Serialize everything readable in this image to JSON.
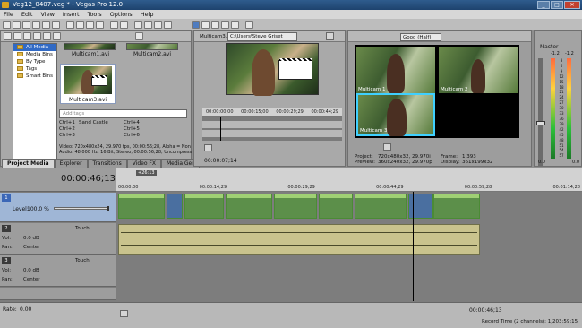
{
  "window": {
    "title": "Veg12_0407.veg * - Vegas Pro 12.0",
    "min": "_",
    "max": "□",
    "close": "✕"
  },
  "menu": [
    "File",
    "Edit",
    "View",
    "Insert",
    "Tools",
    "Options",
    "Help"
  ],
  "explorer": {
    "tree": [
      "All Media",
      "Media Bins",
      "By Type",
      "Tags",
      "Smart Bins"
    ],
    "thumbs": [
      "Multicam1.avi",
      "Multicam2.avi",
      "Multicam3.avi"
    ],
    "search_placeholder": "Add tags",
    "tags": [
      {
        "name": "Sand Castle",
        "keys": "Ctrl+4"
      },
      {
        "name": "",
        "keys": "Ctrl+5"
      },
      {
        "name": "",
        "keys": "Ctrl+6"
      }
    ],
    "left_keys": [
      "Ctrl+1",
      "Ctrl+2",
      "Ctrl+3"
    ],
    "info_video": "Video: 720x480x24, 29.970 fps, 00:00:56;28, Alpha = Non",
    "info_audio": "Audio: 48,000 Hz, 16 Bit, Stereo, 00:00:56;28, Uncompress",
    "tabs": [
      "Project Media",
      "Explorer",
      "Transitions",
      "Video FX",
      "Media Ger"
    ]
  },
  "trimmer": {
    "clip": "Multicam3.avi",
    "path": "C:\\Users\\Steve Griset",
    "ruler": [
      "00:00:00;00",
      "00:00:15;00",
      "00:00:29;29",
      "00:00:44;29"
    ],
    "timecode": "00:00:07;14"
  },
  "preview": {
    "quality": "Good (Half)",
    "labels": [
      "Multicam 1",
      "Multicam 2",
      "Multicam 3"
    ],
    "project_label": "Project:",
    "project_val": "720x480x32, 29.970i",
    "preview_label": "Preview:",
    "preview_val": "360x240x32, 29.970p",
    "frame_label": "Frame:",
    "frame_val": "1,393",
    "display_label": "Display:",
    "display_val": "361x199x32"
  },
  "master": {
    "title": "Master",
    "peaks": [
      "-1.2",
      "-1.2"
    ],
    "scale": [
      "3",
      "6",
      "9",
      "12",
      "15",
      "18",
      "21",
      "24",
      "27",
      "30",
      "33",
      "36",
      "39",
      "42",
      "45",
      "48",
      "51",
      "54",
      "57"
    ],
    "level": "0.0",
    "level2": "0.0"
  },
  "timeline": {
    "timecode": "00:00:46;13",
    "marker": "+26:13",
    "ruler": [
      "00:00:00",
      "00:00:14;29",
      "00:00:29;29",
      "00:00:44;29",
      "00:00:59;28",
      "00:01:14;28"
    ],
    "video_track": {
      "num": "1",
      "label": "Level:",
      "value": "100.0 %"
    },
    "audio_tracks": [
      {
        "num": "2",
        "mode": "Touch",
        "vol_label": "Vol:",
        "vol_val": "0.0 dB",
        "pan_label": "Pan:",
        "pan_val": "Center"
      },
      {
        "num": "3",
        "mode": "Touch",
        "vol_label": "Vol:",
        "vol_val": "0.0 dB",
        "pan_label": "Pan:",
        "pan_val": "Center"
      }
    ],
    "rate_label": "Rate:",
    "rate_val": "0.00",
    "end_timecode": "00:00:46;13",
    "record_time": "Record Time (2 channels): 1,203:59:15"
  },
  "colors": {
    "accent": "#316ac5",
    "clip": "#5c8f4a",
    "audio": "#c9c38d",
    "timeline_bg": "#7d7d7d"
  }
}
